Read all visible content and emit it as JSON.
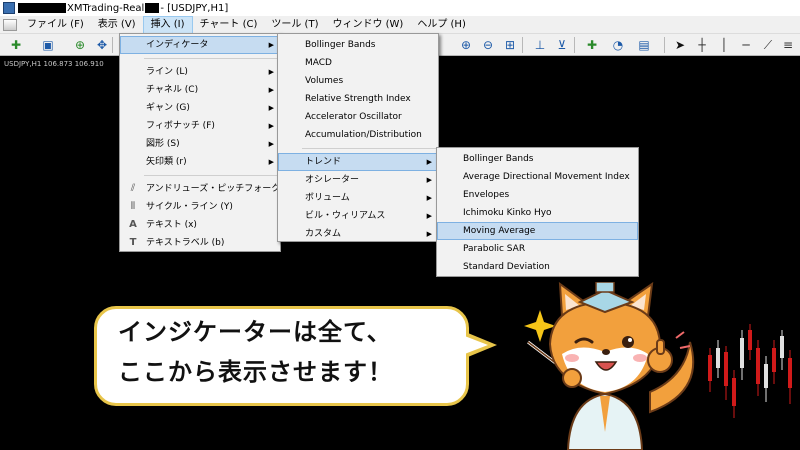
{
  "window": {
    "title_suffix": "XMTrading-Real",
    "title_tail": " - [USDJPY,H1]"
  },
  "menubar": {
    "items": [
      {
        "label": "ファイル (F)"
      },
      {
        "label": "表示 (V)"
      },
      {
        "label": "挿入 (I)"
      },
      {
        "label": "チャート (C)"
      },
      {
        "label": "ツール (T)"
      },
      {
        "label": "ウィンドウ (W)"
      },
      {
        "label": "ヘルプ (H)"
      }
    ]
  },
  "chart": {
    "symbol_label": "USDJPY,H1  106.873 106.910"
  },
  "insert_menu": {
    "items": [
      {
        "label": "インディケータ"
      },
      {
        "label": "ライン (L)"
      },
      {
        "label": "チャネル (C)"
      },
      {
        "label": "ギャン (G)"
      },
      {
        "label": "フィボナッチ (F)"
      },
      {
        "label": "図形 (S)"
      },
      {
        "label": "矢印類 (r)"
      },
      {
        "label": "アンドリューズ・ピッチフォーク (A)"
      },
      {
        "label": "サイクル・ライン (Y)"
      },
      {
        "label": "テキスト (x)"
      },
      {
        "label": "テキストラベル (b)"
      }
    ]
  },
  "indicator_menu": {
    "items": [
      {
        "label": "Bollinger Bands"
      },
      {
        "label": "MACD"
      },
      {
        "label": "Volumes"
      },
      {
        "label": "Relative Strength Index"
      },
      {
        "label": "Accelerator Oscillator"
      },
      {
        "label": "Accumulation/Distribution"
      },
      {
        "label": "トレンド"
      },
      {
        "label": "オシレーター"
      },
      {
        "label": "ボリューム"
      },
      {
        "label": "ビル・ウィリアムス"
      },
      {
        "label": "カスタム"
      }
    ]
  },
  "trend_menu": {
    "items": [
      {
        "label": "Bollinger Bands"
      },
      {
        "label": "Average Directional Movement Index"
      },
      {
        "label": "Envelopes"
      },
      {
        "label": "Ichimoku Kinko Hyo"
      },
      {
        "label": "Moving Average"
      },
      {
        "label": "Parabolic SAR"
      },
      {
        "label": "Standard Deviation"
      }
    ]
  },
  "callout": {
    "line1": "インジケーターは全て、",
    "line2": "ここから表示させます！"
  },
  "colors": {
    "highlight": "#c6dcf1",
    "bubble_border": "#e8c54a",
    "candle_up": "#e0e0e0",
    "candle_down": "#d11a1a"
  }
}
